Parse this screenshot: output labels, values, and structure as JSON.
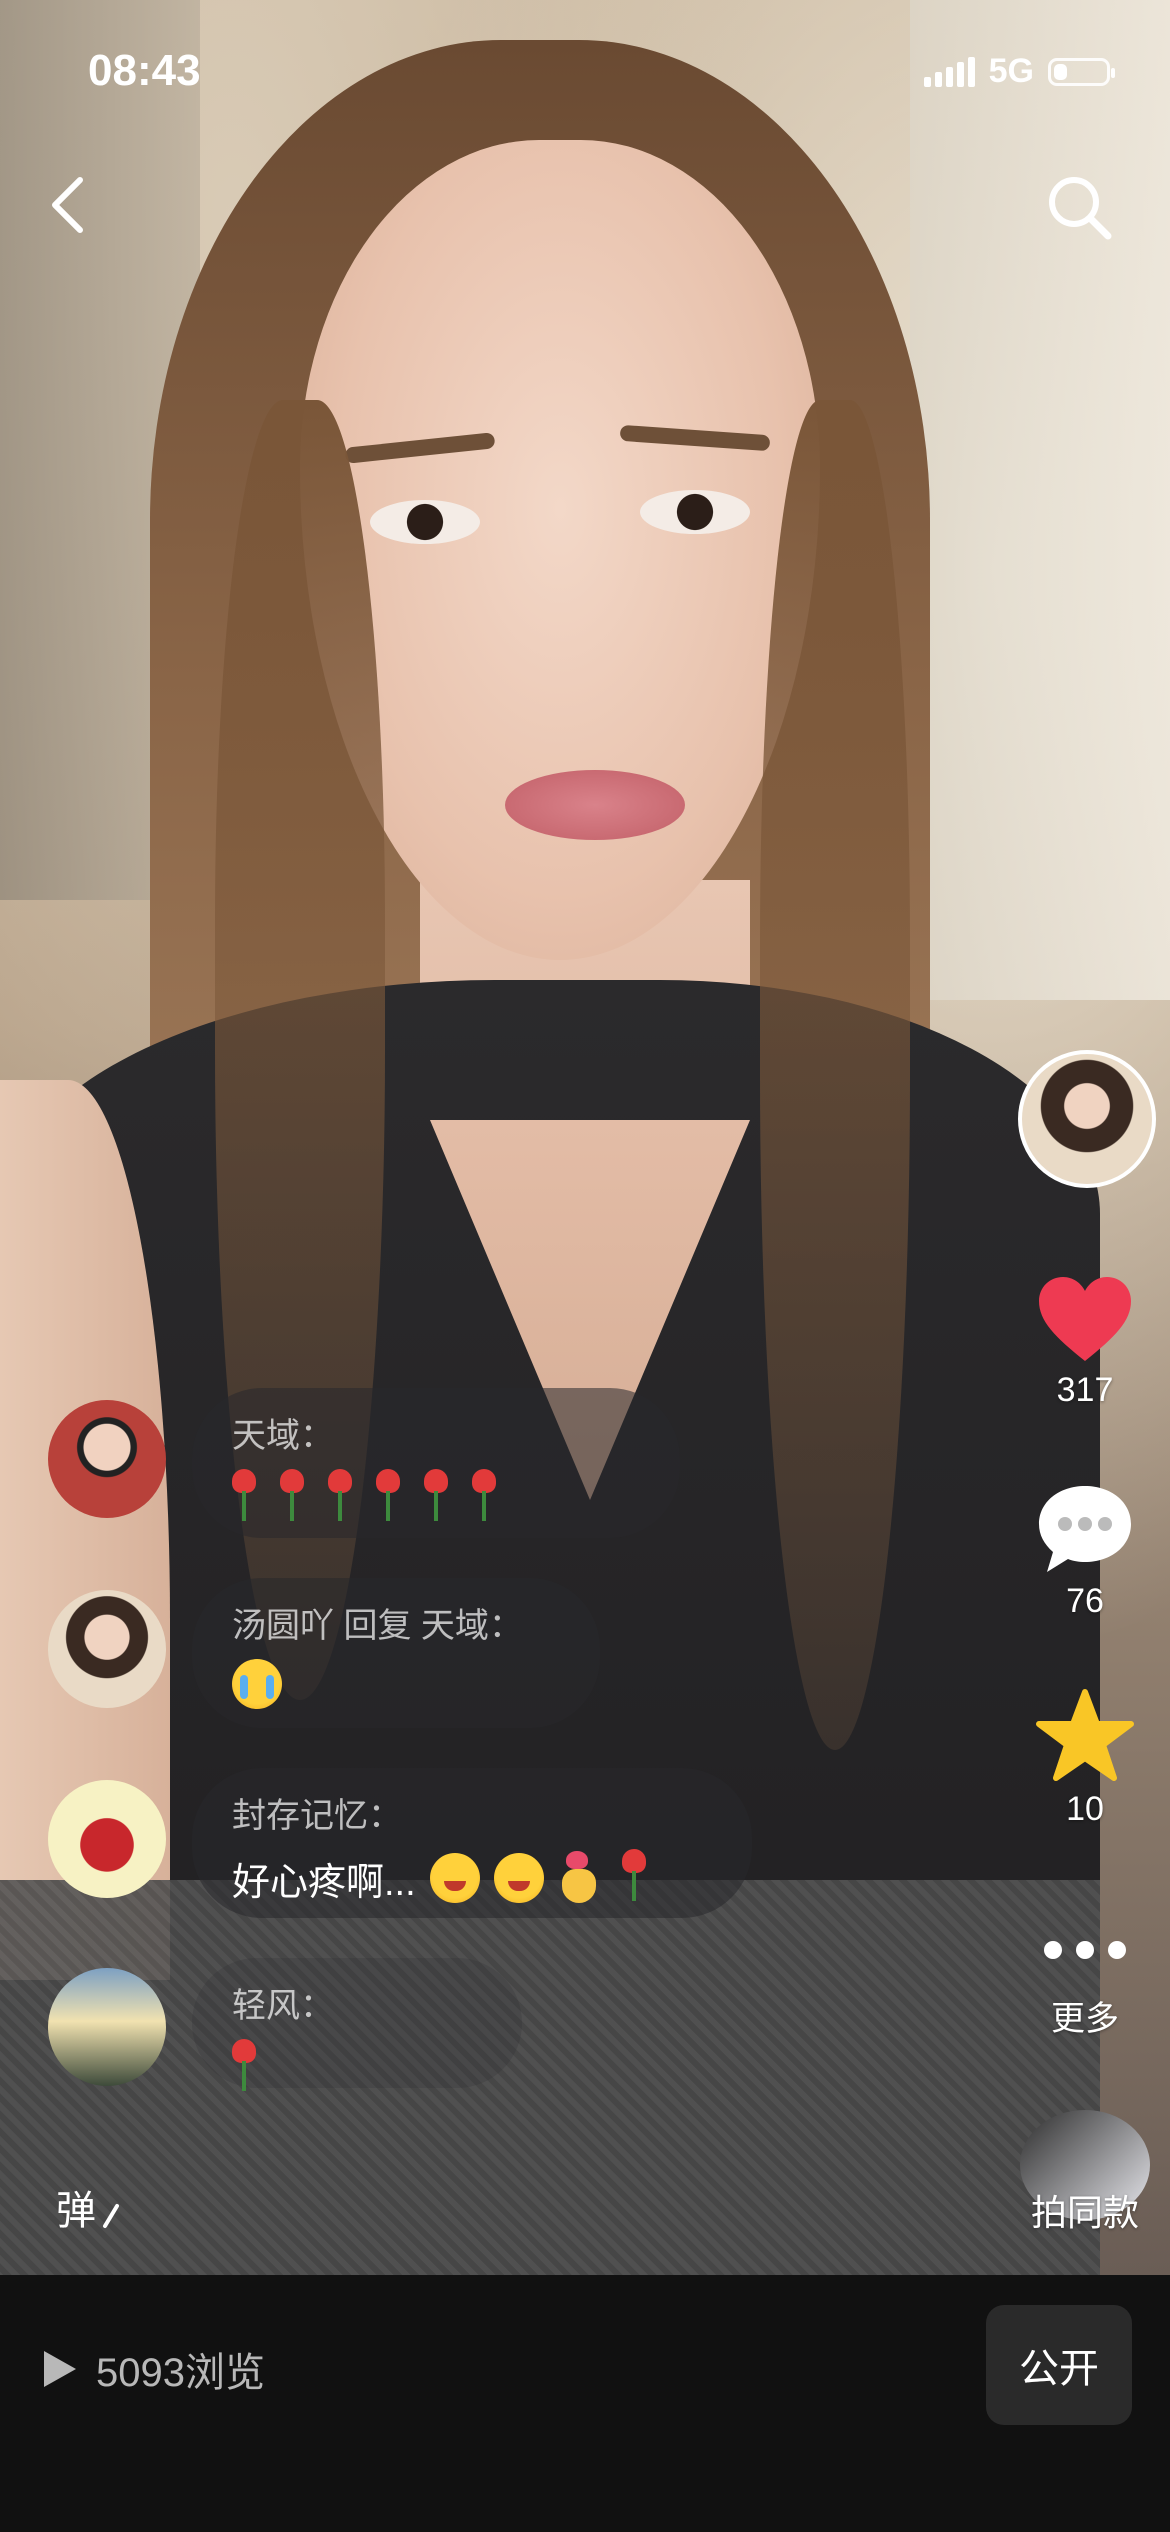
{
  "status": {
    "time": "08:43",
    "network": "5G",
    "battery_level": 0.25
  },
  "nav": {
    "back_icon": "chevron-left-icon",
    "search_icon": "search-icon"
  },
  "rail": {
    "likes": "317",
    "comments": "76",
    "favorites": "10",
    "more_label": "更多",
    "same_style_label": "拍同款",
    "colors": {
      "heart": "#ee3a52",
      "star": "#f9c626"
    }
  },
  "comments": [
    {
      "name": "天域：",
      "text": ""
    },
    {
      "name": "汤圆吖 回复 天域：",
      "text": ""
    },
    {
      "name": "封存记忆：",
      "text": "好心疼啊..."
    },
    {
      "name": "轻风：",
      "text": ""
    }
  ],
  "danmu_label": "弹",
  "footer": {
    "views": "5093浏览",
    "public_label": "公开"
  }
}
